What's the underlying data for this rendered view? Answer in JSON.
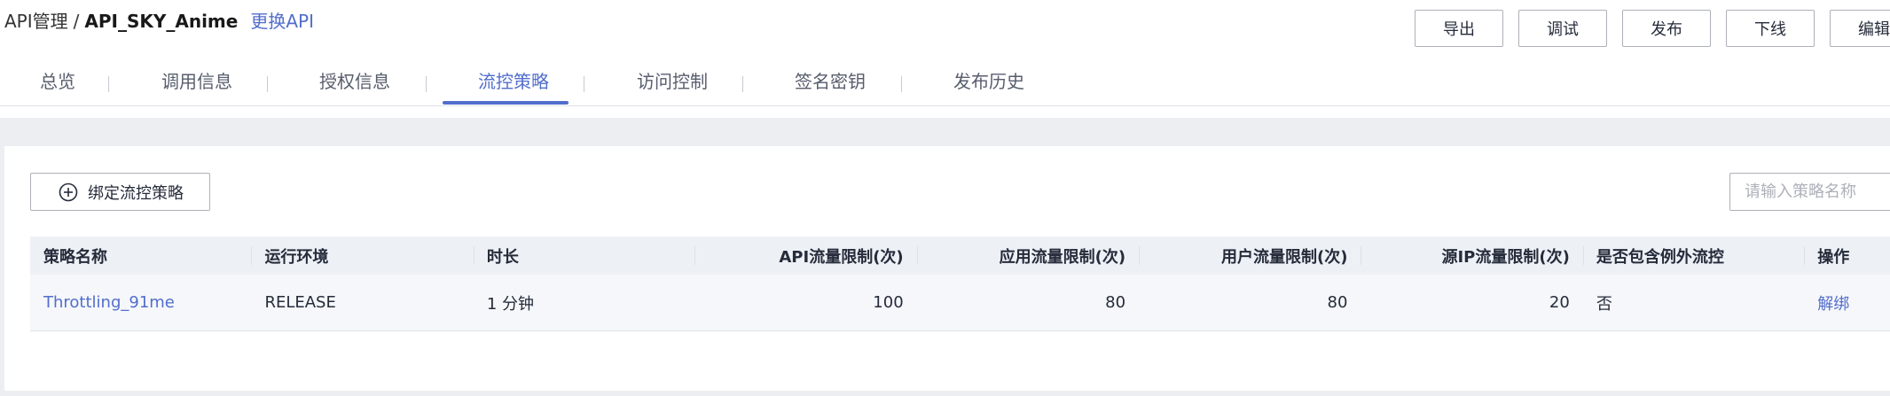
{
  "breadcrumb": {
    "root": "API管理",
    "separator": "/",
    "current": "API_SKY_Anime",
    "change_link": "更换API"
  },
  "actions": {
    "export": "导出",
    "debug": "调试",
    "publish": "发布",
    "offline": "下线",
    "edit": "编辑"
  },
  "tabs": [
    {
      "label": "总览",
      "active": false
    },
    {
      "label": "调用信息",
      "active": false
    },
    {
      "label": "授权信息",
      "active": false
    },
    {
      "label": "流控策略",
      "active": true
    },
    {
      "label": "访问控制",
      "active": false
    },
    {
      "label": "签名密钥",
      "active": false
    },
    {
      "label": "发布历史",
      "active": false
    }
  ],
  "toolbar": {
    "bind_button_label": "绑定流控策略",
    "bind_button_icon": "plus-circle-icon",
    "search_placeholder": "请输入策略名称"
  },
  "table": {
    "columns": [
      "策略名称",
      "运行环境",
      "时长",
      "API流量限制(次)",
      "应用流量限制(次)",
      "用户流量限制(次)",
      "源IP流量限制(次)",
      "是否包含例外流控",
      "操作"
    ],
    "rows": [
      {
        "name": "Throttling_91me",
        "env": "RELEASE",
        "duration": "1 分钟",
        "api_limit": "100",
        "app_limit": "80",
        "user_limit": "80",
        "ip_limit": "20",
        "has_exception": "否",
        "action": "解绑"
      }
    ]
  },
  "colors": {
    "accent": "#526ecc",
    "text": "#252b3a",
    "border": "#adb0b8",
    "band": "#eceef2",
    "table_header": "#edf0f5"
  }
}
